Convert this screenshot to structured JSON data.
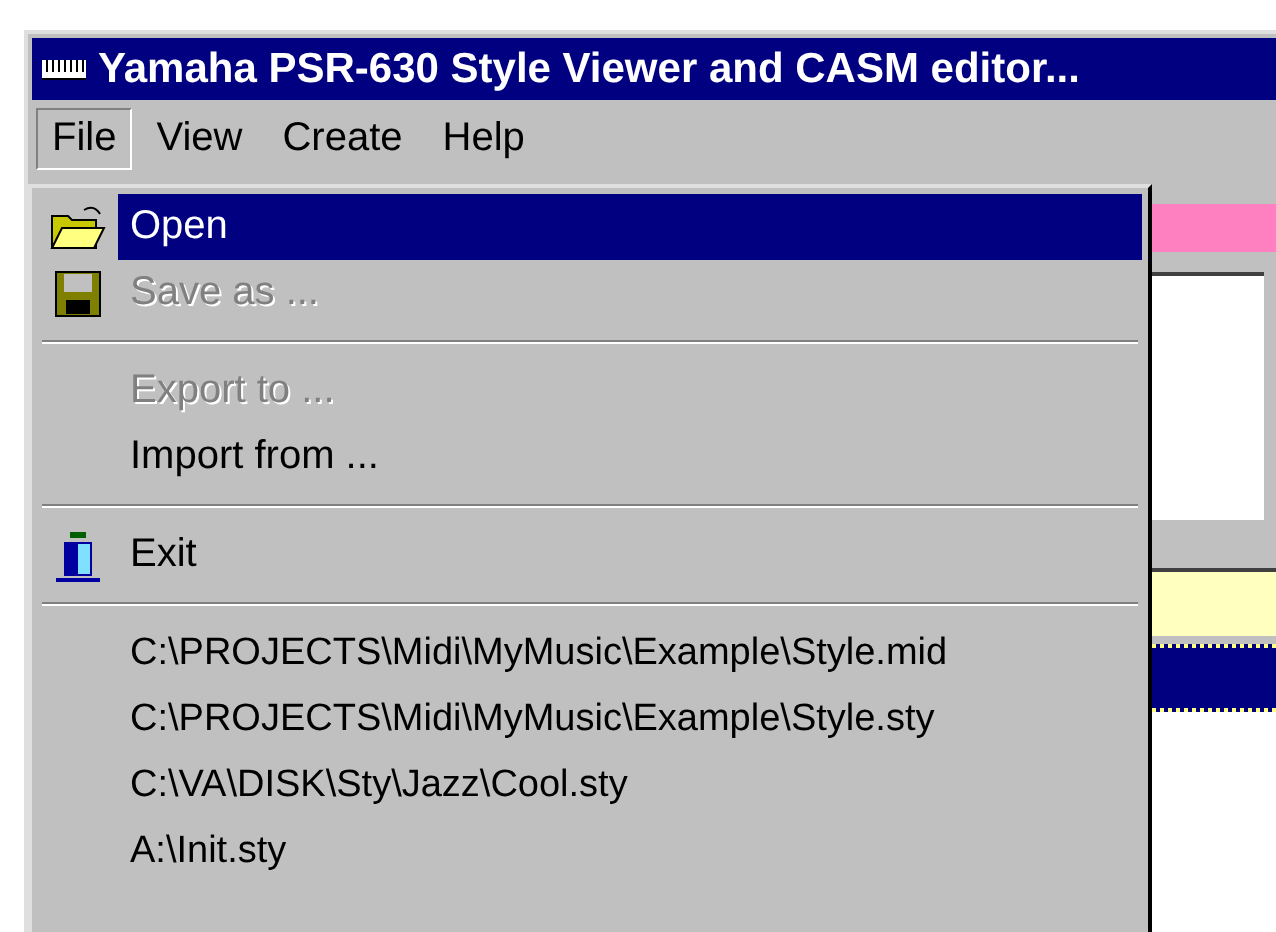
{
  "window": {
    "title": "Yamaha PSR-630 Style Viewer and CASM editor..."
  },
  "menu_bar": [
    {
      "label": "File",
      "selected": true
    },
    {
      "label": "View",
      "selected": false
    },
    {
      "label": "Create",
      "selected": false
    },
    {
      "label": "Help",
      "selected": false
    }
  ],
  "file_menu": [
    {
      "kind": "open",
      "label": "Open",
      "selected": true,
      "disabled": false
    },
    {
      "kind": "save",
      "label": "Save as ...",
      "selected": false,
      "disabled": true
    },
    {
      "kind": "separator"
    },
    {
      "kind": "command",
      "label": "Export to ...",
      "selected": false,
      "disabled": true
    },
    {
      "kind": "command",
      "label": "Import from ...",
      "selected": false,
      "disabled": false
    },
    {
      "kind": "separator"
    },
    {
      "kind": "exit",
      "label": "Exit",
      "selected": false,
      "disabled": false
    },
    {
      "kind": "separator"
    },
    {
      "kind": "recent",
      "label": "C:\\PROJECTS\\Midi\\MyMusic\\Example\\Style.mid",
      "selected": false,
      "disabled": false
    },
    {
      "kind": "recent",
      "label": "C:\\PROJECTS\\Midi\\MyMusic\\Example\\Style.sty",
      "selected": false,
      "disabled": false
    },
    {
      "kind": "recent",
      "label": "C:\\VA\\DISK\\Sty\\Jazz\\Cool.sty",
      "selected": false,
      "disabled": false
    },
    {
      "kind": "recent",
      "label": "A:\\Init.sty",
      "selected": false,
      "disabled": false
    }
  ]
}
